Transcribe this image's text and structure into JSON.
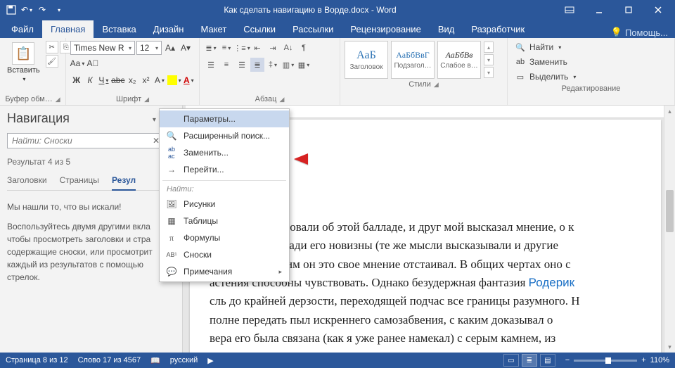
{
  "titlebar": {
    "title": "Как сделать навигацию в Ворде.docx - Word"
  },
  "tabs": {
    "file": "Файл",
    "home": "Главная",
    "insert": "Вставка",
    "design": "Дизайн",
    "layout": "Макет",
    "references": "Ссылки",
    "mailings": "Рассылки",
    "review": "Рецензирование",
    "view": "Вид",
    "developer": "Разработчик",
    "help": "Помощь..."
  },
  "ribbon": {
    "clipboard": {
      "paste": "Вставить",
      "label": "Буфер обм…"
    },
    "font": {
      "family": "Times New R",
      "size": "12",
      "label": "Шрифт",
      "bold": "Ж",
      "italic": "К",
      "underline": "Ч",
      "strike": "abc",
      "sub": "x₂",
      "sup": "x²"
    },
    "paragraph": {
      "label": "Абзац"
    },
    "styles": {
      "label": "Стили",
      "items": [
        {
          "preview": "АаБ",
          "name": "Заголовок",
          "head": true
        },
        {
          "preview": "АаБбВвГ",
          "name": "Подзагол…",
          "head": true
        },
        {
          "preview": "АаБбВв",
          "name": "Слабое в…",
          "head": false
        }
      ]
    },
    "editing": {
      "label": "Редактирование",
      "find": "Найти",
      "replace": "Заменить",
      "select": "Выделить"
    }
  },
  "nav": {
    "title": "Навигация",
    "search_value": "Найти: Сноски",
    "result": "Результат 4 из 5",
    "tabs": {
      "headings": "Заголовки",
      "pages": "Страницы",
      "results": "Резул"
    },
    "body1": "Мы нашли то, что вы искали!",
    "body2": "Воспользуйтесь двумя другими вкла чтобы просмотреть заголовки и стра содержащие сноски, или просмотрит каждый из результатов с помощью стрелок."
  },
  "ddmenu": {
    "options": "Параметры...",
    "advanced": "Расширенный поиск...",
    "replace": "Заменить...",
    "goto": "Перейти...",
    "find_label": "Найти:",
    "pictures": "Рисунки",
    "tables": "Таблицы",
    "formulas": "Формулы",
    "footnotes": "Сноски",
    "comments": "Примечания"
  },
  "doc": {
    "text_html": "потом мы беседовали об этой балладе, и друг мой высказал мнение, о к<br>аю не столько ради его новизны (те же мысли высказывали и другие<br>упорства, с каким он это свое мнение отстаивал. В общих чертах оно с<br>астения способны чувствовать. Однако безудержная фантазия <span class='link'>Родерик</span><br>сль до крайней дерзости, переходящей подчас все границы разумного. Н<br>полне передать пыл искреннего самозабвения, с каким доказывал о<br>вера его была связана (как я уже ранее намекал) с серым камнем, из"
  },
  "status": {
    "page": "Страница 8 из 12",
    "words": "Слово 17 из 4567",
    "lang": "русский",
    "zoom": "110%"
  }
}
